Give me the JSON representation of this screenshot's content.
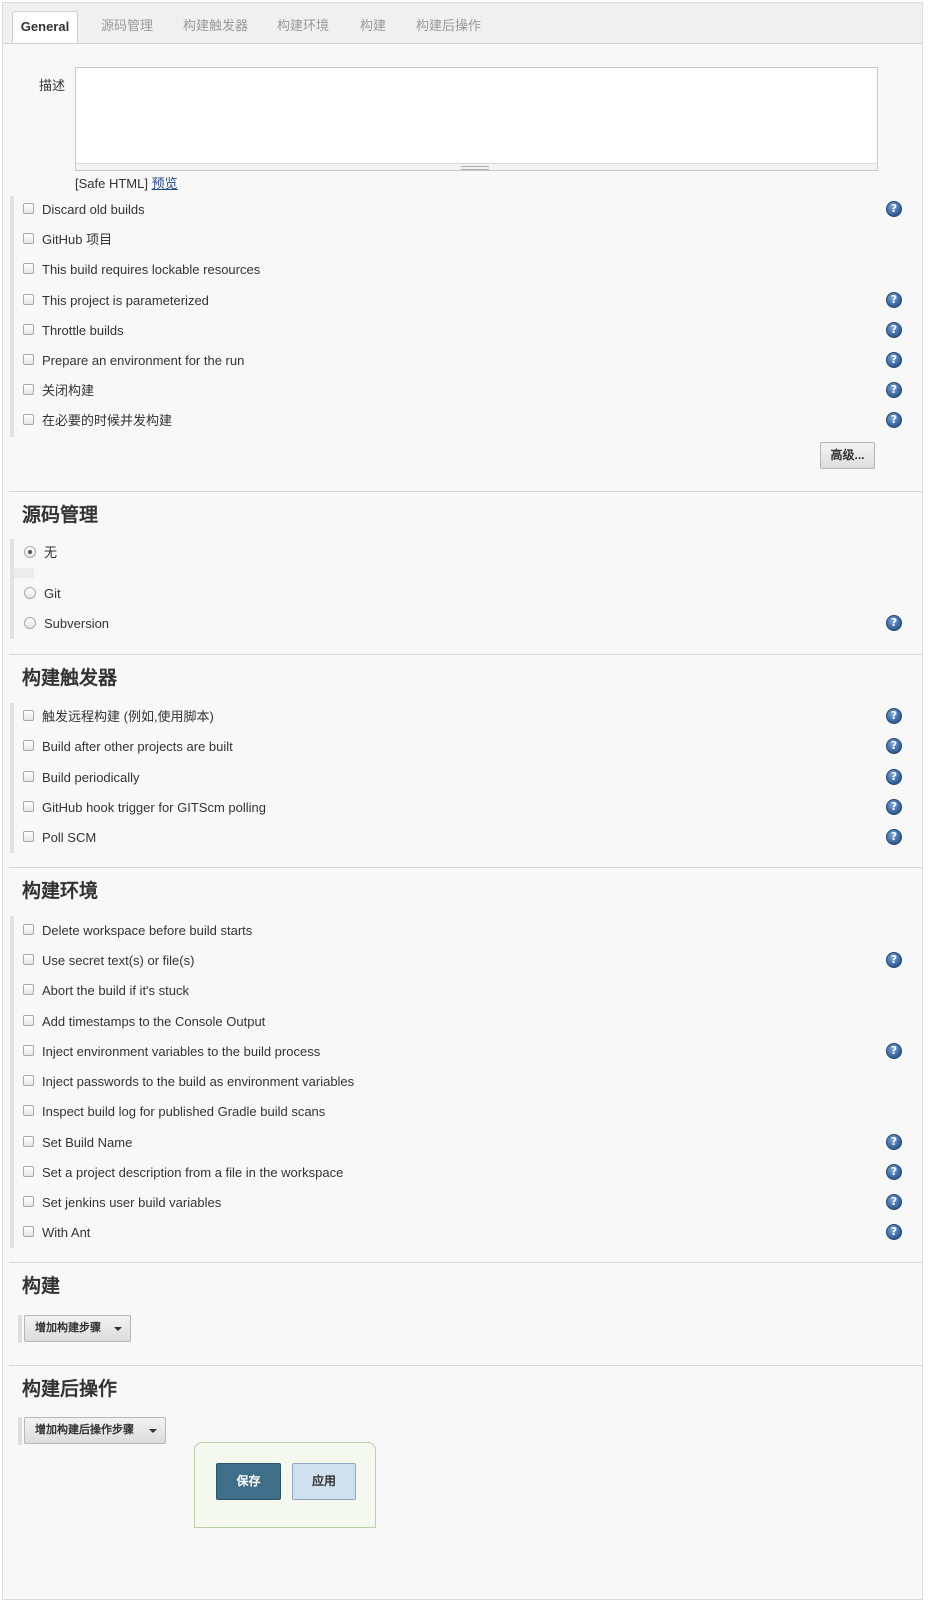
{
  "tabs": [
    {
      "label": "General",
      "active": true
    },
    {
      "label": "源码管理"
    },
    {
      "label": "构建触发器"
    },
    {
      "label": "构建环境"
    },
    {
      "label": "构建"
    },
    {
      "label": "构建后操作"
    }
  ],
  "general": {
    "description_label": "描述",
    "description_value": "",
    "safe_html": "[Safe HTML]",
    "preview_link": "预览",
    "options": [
      {
        "label": "Discard old builds",
        "help": true
      },
      {
        "label": "GitHub 项目",
        "help": false
      },
      {
        "label": "This build requires lockable resources",
        "help": false
      },
      {
        "label": "This project is parameterized",
        "help": true
      },
      {
        "label": "Throttle builds",
        "help": true
      },
      {
        "label": "Prepare an environment for the run",
        "help": true
      },
      {
        "label": "关闭构建",
        "help": true
      },
      {
        "label": "在必要的时候并发构建",
        "help": true
      }
    ],
    "advanced_button": "高级..."
  },
  "scm": {
    "title": "源码管理",
    "options": [
      {
        "label": "无",
        "selected": true,
        "help": false
      },
      {
        "label": "Git",
        "selected": false,
        "help": false
      },
      {
        "label": "Subversion",
        "selected": false,
        "help": true
      }
    ]
  },
  "triggers": {
    "title": "构建触发器",
    "options": [
      {
        "label": "触发远程构建 (例如,使用脚本)",
        "help": true
      },
      {
        "label": "Build after other projects are built",
        "help": true
      },
      {
        "label": "Build periodically",
        "help": true
      },
      {
        "label": "GitHub hook trigger for GITScm polling",
        "help": true
      },
      {
        "label": "Poll SCM",
        "help": true
      }
    ]
  },
  "environment": {
    "title": "构建环境",
    "options": [
      {
        "label": "Delete workspace before build starts",
        "help": false
      },
      {
        "label": "Use secret text(s) or file(s)",
        "help": true
      },
      {
        "label": "Abort the build if it's stuck",
        "help": false
      },
      {
        "label": "Add timestamps to the Console Output",
        "help": false
      },
      {
        "label": "Inject environment variables to the build process",
        "help": true
      },
      {
        "label": "Inject passwords to the build as environment variables",
        "help": false
      },
      {
        "label": "Inspect build log for published Gradle build scans",
        "help": false
      },
      {
        "label": "Set Build Name",
        "help": true
      },
      {
        "label": "Set a project description from a file in the workspace",
        "help": true
      },
      {
        "label": "Set jenkins user build variables",
        "help": true
      },
      {
        "label": "With Ant",
        "help": true
      }
    ]
  },
  "build": {
    "title": "构建",
    "add_step_button": "增加构建步骤"
  },
  "post_build": {
    "title": "构建后操作",
    "add_step_button": "增加构建后操作步骤"
  },
  "actions": {
    "save": "保存",
    "apply": "应用"
  },
  "colors": {
    "save_button": "#3f6f88",
    "apply_button": "#cfe0ef",
    "help_icon": "#2f5d94",
    "link": "#204a87"
  }
}
